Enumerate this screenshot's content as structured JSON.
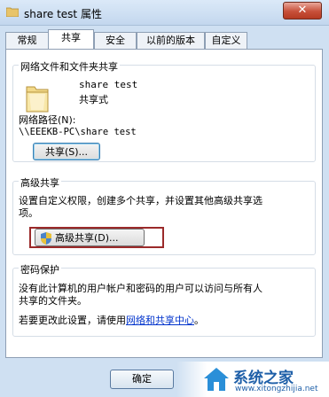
{
  "window": {
    "title": "share test 属性",
    "close_symbol": "✕"
  },
  "tabs": [
    "常规",
    "共享",
    "安全",
    "以前的版本",
    "自定义"
  ],
  "network_sharing": {
    "heading": "网络文件和文件夹共享",
    "folder_name": "share test",
    "share_state": "共享式",
    "path_label": "网络路径(N):",
    "path_value": "\\\\EEEKB-PC\\share test",
    "share_button": "共享(S)..."
  },
  "advanced_sharing": {
    "heading": "高级共享",
    "description_line1": "设置自定义权限，创建多个共享，并设置其他高级共享选",
    "description_line2": "项。",
    "button": "高级共享(D)..."
  },
  "password_protection": {
    "heading": "密码保护",
    "line1": "没有此计算机的用户帐户和密码的用户可以访问与所有人",
    "line2": "共享的文件夹。",
    "change_prefix": "若要更改此设置，请使用",
    "link": "网络和共享中心",
    "change_suffix": "。"
  },
  "footer": {
    "ok_button": "确定"
  },
  "watermark": {
    "brand": "系统之家",
    "url": "www.xitongzhijia.net"
  },
  "colors": {
    "accent": "#2a6fb5",
    "close": "#c7503a",
    "link": "#0033cc"
  }
}
